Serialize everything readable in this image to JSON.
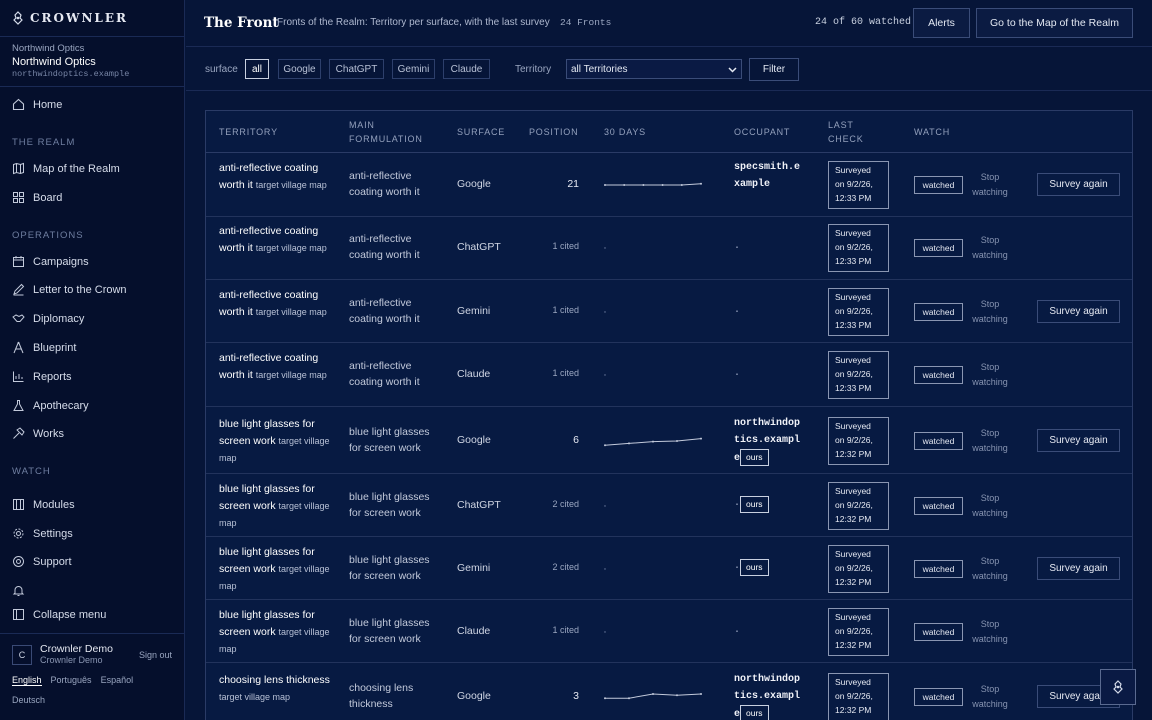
{
  "brand": {
    "name": "CROWNLER"
  },
  "org": {
    "label": "Northwind Optics",
    "name": "Northwind Optics",
    "domain": "northwindoptics.example"
  },
  "nav": {
    "home": "Home",
    "section_realm": "THE REALM",
    "map": "Map of the Realm",
    "board": "Board",
    "section_ops": "OPERATIONS",
    "campaigns": "Campaigns",
    "letter": "Letter to the Crown",
    "diplomacy": "Diplomacy",
    "blueprint": "Blueprint",
    "reports": "Reports",
    "apothecary": "Apothecary",
    "works": "Works",
    "section_watch": "WATCH",
    "modules": "Modules",
    "settings": "Settings",
    "support": "Support",
    "collapse": "Collapse menu"
  },
  "user": {
    "initial": "C",
    "name": "Crownler Demo",
    "sub": "Crownler Demo",
    "signout": "Sign out"
  },
  "languages": [
    "English",
    "Português",
    "Español",
    "Deutsch"
  ],
  "header": {
    "title": "The Front",
    "subtitle": "Fronts of the Realm: Territory per surface, with the last survey",
    "count": "24 Fronts",
    "watched": "24 of 60 watched",
    "alerts": "Alerts",
    "map_button": "Go to the Map of the Realm"
  },
  "filters": {
    "surface_label": "surface",
    "surfaces": [
      "all",
      "Google",
      "ChatGPT",
      "Gemini",
      "Claude"
    ],
    "active_surface": "all",
    "territory_label": "Territory",
    "territory_value": "all Territories",
    "filter_button": "Filter"
  },
  "table": {
    "headers": {
      "territory": "TERRITORY",
      "formulation_1": "MAIN",
      "formulation_2": "FORMULATION",
      "surface": "SURFACE",
      "position": "POSITION",
      "days": "30 DAYS",
      "occupant": "OCCUPANT",
      "check_1": "LAST",
      "check_2": "CHECK",
      "watch": "WATCH"
    },
    "map_link": "target village map",
    "watched_label": "watched",
    "stop_label": "Stop watching",
    "survey_label": "Survey again",
    "ours_label": "ours",
    "rows": [
      {
        "territory": "anti-reflective coating worth it",
        "formulation": "anti-reflective coating worth it",
        "surface": "Google",
        "position": "21",
        "position_small": false,
        "occupant": "specsmith.example",
        "ours": false,
        "check_1": "Surveyed",
        "check_2": "on 9/2/26,",
        "check_3": "12:33 PM",
        "survey": true,
        "spark": [
          0.5,
          0.5,
          0.5,
          0.5,
          0.5,
          0.4
        ]
      },
      {
        "territory": "anti-reflective coating worth it",
        "formulation": "anti-reflective coating worth it",
        "surface": "ChatGPT",
        "position": "1 cited",
        "position_small": true,
        "occupant": "·",
        "ours": false,
        "check_1": "Surveyed",
        "check_2": "on 9/2/26,",
        "check_3": "12:33 PM",
        "survey": false,
        "spark": []
      },
      {
        "territory": "anti-reflective coating worth it",
        "formulation": "anti-reflective coating worth it",
        "surface": "Gemini",
        "position": "1 cited",
        "position_small": true,
        "occupant": "·",
        "ours": false,
        "check_1": "Surveyed",
        "check_2": "on 9/2/26,",
        "check_3": "12:33 PM",
        "survey": true,
        "spark": []
      },
      {
        "territory": "anti-reflective coating worth it",
        "formulation": "anti-reflective coating worth it",
        "surface": "Claude",
        "position": "1 cited",
        "position_small": true,
        "occupant": "·",
        "ours": false,
        "check_1": "Surveyed",
        "check_2": "on 9/2/26,",
        "check_3": "12:33 PM",
        "survey": false,
        "spark": []
      },
      {
        "territory": "blue light glasses for screen work",
        "formulation": "blue light glasses for screen work",
        "surface": "Google",
        "position": "6",
        "position_small": false,
        "occupant": "northwindoptics.example",
        "ours": true,
        "check_1": "Surveyed",
        "check_2": "on 9/2/26,",
        "check_3": "12:32 PM",
        "survey": true,
        "spark": [
          0.85,
          0.7,
          0.55,
          0.5,
          0.3
        ]
      },
      {
        "territory": "blue light glasses for screen work",
        "formulation": "blue light glasses for screen work",
        "surface": "ChatGPT",
        "position": "2 cited",
        "position_small": true,
        "occupant": "·",
        "ours": true,
        "check_1": "Surveyed",
        "check_2": "on 9/2/26,",
        "check_3": "12:32 PM",
        "survey": false,
        "spark": []
      },
      {
        "territory": "blue light glasses for screen work",
        "formulation": "blue light glasses for screen work",
        "surface": "Gemini",
        "position": "2 cited",
        "position_small": true,
        "occupant": "·",
        "ours": true,
        "check_1": "Surveyed",
        "check_2": "on 9/2/26,",
        "check_3": "12:32 PM",
        "survey": true,
        "spark": []
      },
      {
        "territory": "blue light glasses for screen work",
        "formulation": "blue light glasses for screen work",
        "surface": "Claude",
        "position": "1 cited",
        "position_small": true,
        "occupant": "·",
        "ours": false,
        "check_1": "Surveyed",
        "check_2": "on 9/2/26,",
        "check_3": "12:32 PM",
        "survey": false,
        "spark": []
      },
      {
        "territory": "choosing lens thickness",
        "formulation": "choosing lens thickness",
        "surface": "Google",
        "position": "3",
        "position_small": false,
        "occupant": "northwindoptics.example",
        "ours": true,
        "check_1": "Surveyed",
        "check_2": "on 9/2/26,",
        "check_3": "12:32 PM",
        "survey": true,
        "spark": [
          0.6,
          0.6,
          0.25,
          0.35,
          0.25
        ]
      }
    ]
  },
  "colors": {
    "bg": "#061538",
    "sidebar": "#050f2c",
    "border": "#2a3b66",
    "accent": "#c8d0e0"
  }
}
